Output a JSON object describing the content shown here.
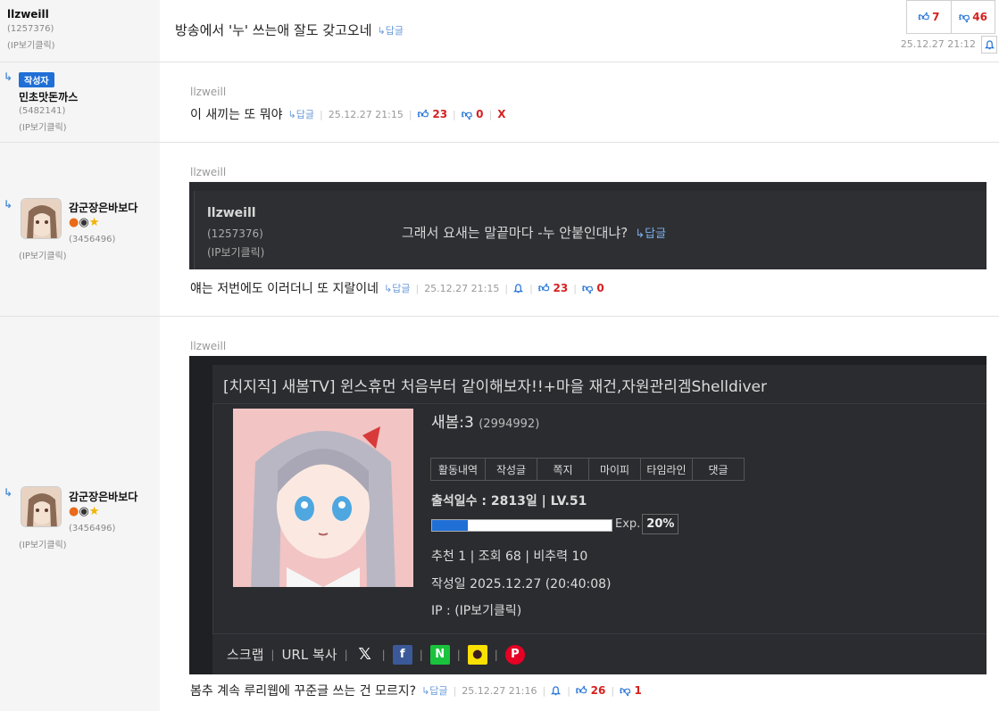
{
  "comments": [
    {
      "nick": "llzweill",
      "uid": "(1257376)",
      "ip": "(IP보기클릭)",
      "text": "방송에서 '누' 쓰는애 잘도 갖고오네",
      "reply": "↳답글",
      "up": "7",
      "down": "46",
      "time": "25.12.27 21:12"
    },
    {
      "badge": "작성자",
      "nick": "민초맛돈까스",
      "uid": "(5482141)",
      "ip": "(IP보기클릭)",
      "quote_nick": "llzweill",
      "text": "이 새끼는 또 뭐야",
      "reply": "↳답글",
      "time": "25.12.27 21:15",
      "up": "23",
      "down": "0",
      "delete": "X"
    },
    {
      "nick": "감군장은바보다",
      "uid": "(3456496)",
      "ip": "(IP보기클릭)",
      "quote_nick": "llzweill",
      "embed": {
        "nick": "llzweill",
        "uid": "(1257376)",
        "ip": "(IP보기클릭)",
        "text": "그래서 요새는 말끝마다 -누 안붙인대냐?",
        "reply": "↳답글"
      },
      "text": "얘는 저번에도 이러더니 또 지랄이네",
      "reply": "↳답글",
      "time": "25.12.27 21:15",
      "up": "23",
      "down": "0"
    },
    {
      "nick": "감군장은바보다",
      "uid": "(3456496)",
      "ip": "(IP보기클릭)",
      "quote_nick": "llzweill",
      "embed": {
        "title": "[치지직] 새봄TV] 윈스휴먼 처음부터 같이해보자!!+마을 재건,자원관리겜Shelldiver",
        "name": "새봄:3",
        "uid": "(2994992)",
        "tabs": [
          "활동내역",
          "작성글",
          "쪽지",
          "마이피",
          "타임라인",
          "댓글"
        ],
        "attendance": "출석일수 : 2813일 | LV.51",
        "exp_label": "Exp.",
        "exp_percent": "20%",
        "exp_fraction": 0.2,
        "stats": "추천 1 | 조회 68 | 비추력 10",
        "date": "작성일 2025.12.27 (20:40:08)",
        "ip": "IP : (IP보기클릭)",
        "footer": [
          "스크랩",
          "URL 복사"
        ]
      },
      "text": "봄추 계속 루리웹에 꾸준글 쓰는 건 모르지?",
      "reply": "↳답글",
      "time": "25.12.27 21:16",
      "up": "26",
      "down": "1"
    }
  ],
  "colors": {
    "accent": "#1f6fd6",
    "down": "#d62020",
    "sidebar": "#f5f5f5"
  }
}
